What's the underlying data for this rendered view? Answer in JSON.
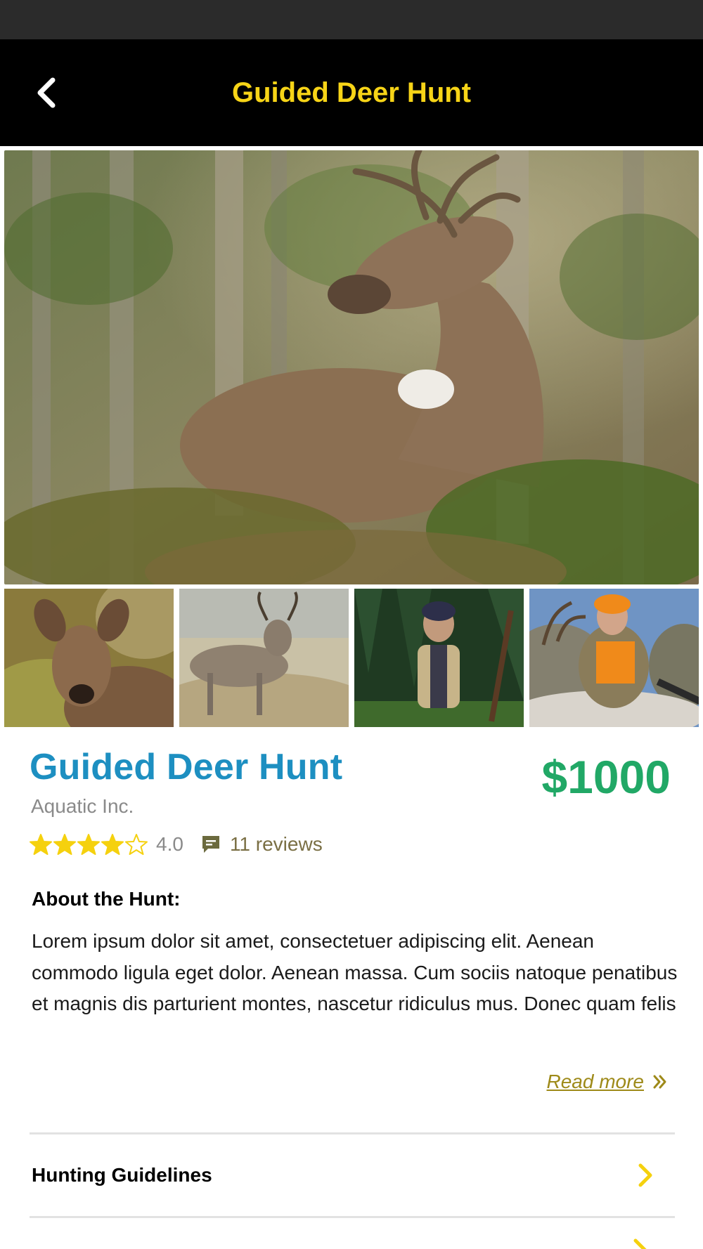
{
  "header": {
    "title": "Guided Deer Hunt",
    "back_icon": "chevron-left-icon"
  },
  "gallery": {
    "hero_image": "buck-deer-in-forest-photo",
    "thumbnails": [
      {
        "name": "doe-deer-photo"
      },
      {
        "name": "buck-in-field-photo"
      },
      {
        "name": "hunter-with-rifle-photo"
      },
      {
        "name": "hunter-with-trophy-buck-photo"
      }
    ]
  },
  "listing": {
    "title": "Guided Deer Hunt",
    "company": "Aquatic Inc.",
    "price": "$1000",
    "rating": 4.0,
    "rating_text": "4.0",
    "rating_max": 5,
    "reviews_text": "11 reviews"
  },
  "about": {
    "heading": "About the Hunt:",
    "body": "Lorem ipsum dolor sit amet, consectetuer adipiscing elit. Aenean commodo ligula eget dolor. Aenean massa. Cum sociis natoque penatibus et magnis dis parturient montes, nascetur ridiculus mus. Donec quam felis",
    "read_more": "Read more"
  },
  "sections": [
    {
      "label": "Hunting Guidelines"
    }
  ],
  "colors": {
    "header_bg": "#000000",
    "header_title": "#f7d417",
    "title": "#1d8fc1",
    "price": "#21a866",
    "star": "#f5d10e",
    "link": "#9e8a19",
    "chevron": "#f5d10e"
  }
}
